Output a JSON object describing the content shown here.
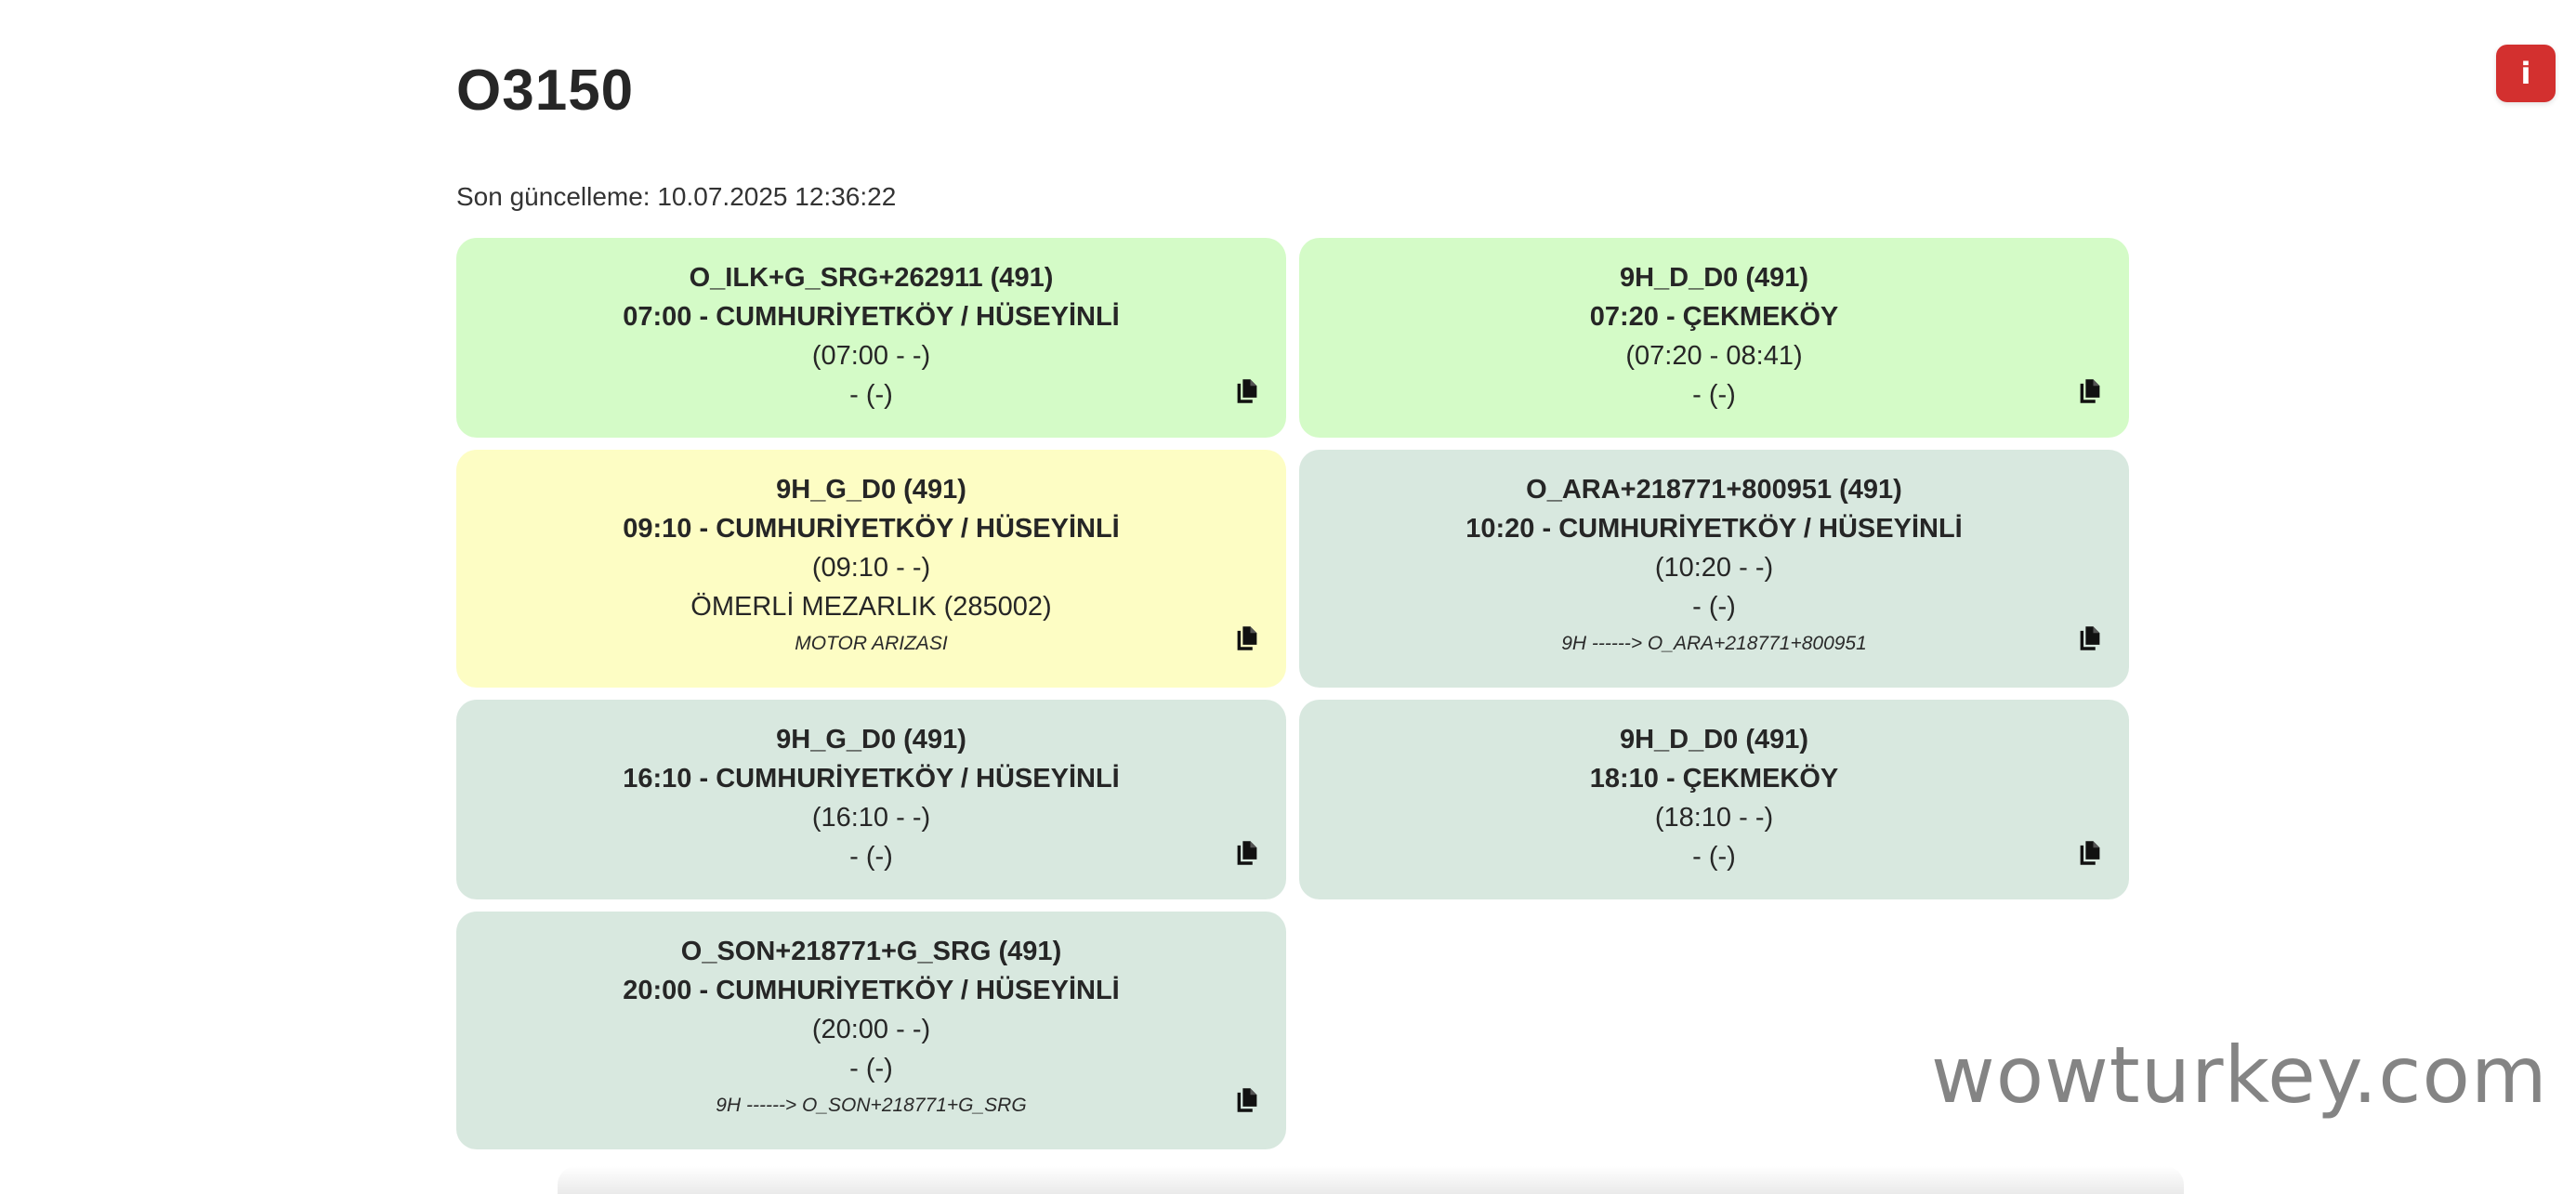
{
  "page": {
    "title": "O3150",
    "last_update": "Son güncelleme: 10.07.2025 12:36:22",
    "info_button_label": "i",
    "watermark": "wowturkey.com"
  },
  "colors": {
    "green_card": "#d4fbc7",
    "yellow_card": "#fdfdc4",
    "gray_card": "#d8e8df",
    "info_button": "#d3302f"
  },
  "cards": [
    {
      "status": "green",
      "code": "O_ILK+G_SRG+262911 (491)",
      "departure": "07:00 - CUMHURİYETKÖY / HÜSEYİNLİ",
      "times": "(07:00 - -)",
      "stop": "- (-)",
      "note": "",
      "copy_icon": "copy-icon"
    },
    {
      "status": "green",
      "code": "9H_D_D0 (491)",
      "departure": "07:20 - ÇEKMEKÖY",
      "times": "(07:20 - 08:41)",
      "stop": "- (-)",
      "note": "",
      "copy_icon": "copy-icon"
    },
    {
      "status": "yellow",
      "code": "9H_G_D0 (491)",
      "departure": "09:10 - CUMHURİYETKÖY / HÜSEYİNLİ",
      "times": "(09:10 - -)",
      "stop": "ÖMERLİ MEZARLIK (285002)",
      "note": "MOTOR ARIZASI",
      "copy_icon": "copy-icon"
    },
    {
      "status": "gray",
      "code": "O_ARA+218771+800951 (491)",
      "departure": "10:20 - CUMHURİYETKÖY / HÜSEYİNLİ",
      "times": "(10:20 - -)",
      "stop": "- (-)",
      "note": "9H ------> O_ARA+218771+800951",
      "copy_icon": "copy-icon"
    },
    {
      "status": "gray",
      "code": "9H_G_D0 (491)",
      "departure": "16:10 - CUMHURİYETKÖY / HÜSEYİNLİ",
      "times": "(16:10 - -)",
      "stop": "- (-)",
      "note": "",
      "copy_icon": "copy-icon"
    },
    {
      "status": "gray",
      "code": "9H_D_D0 (491)",
      "departure": "18:10 - ÇEKMEKÖY",
      "times": "(18:10 - -)",
      "stop": "- (-)",
      "note": "",
      "copy_icon": "copy-icon"
    },
    {
      "status": "gray",
      "code": "O_SON+218771+G_SRG (491)",
      "departure": "20:00 - CUMHURİYETKÖY / HÜSEYİNLİ",
      "times": "(20:00 - -)",
      "stop": "- (-)",
      "note": "9H ------> O_SON+218771+G_SRG",
      "copy_icon": "copy-icon"
    }
  ]
}
